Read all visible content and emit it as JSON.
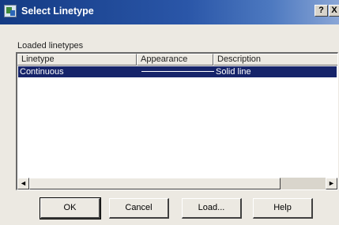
{
  "window": {
    "title": "Select Linetype",
    "help_glyph": "?",
    "close_glyph": "X"
  },
  "loaded_label": "Loaded linetypes",
  "list": {
    "columns": [
      "Linetype",
      "Appearance",
      "Description"
    ],
    "rows": [
      {
        "linetype": "Continuous",
        "appearance": "solid-line",
        "description": "Solid line",
        "selected": true
      }
    ]
  },
  "scrollbar": {
    "left_glyph": "◄",
    "right_glyph": "►"
  },
  "buttons": {
    "ok": "OK",
    "cancel": "Cancel",
    "load": "Load...",
    "help": "Help"
  },
  "colors": {
    "selection": "#16246a",
    "titlebar": "#143b84"
  }
}
